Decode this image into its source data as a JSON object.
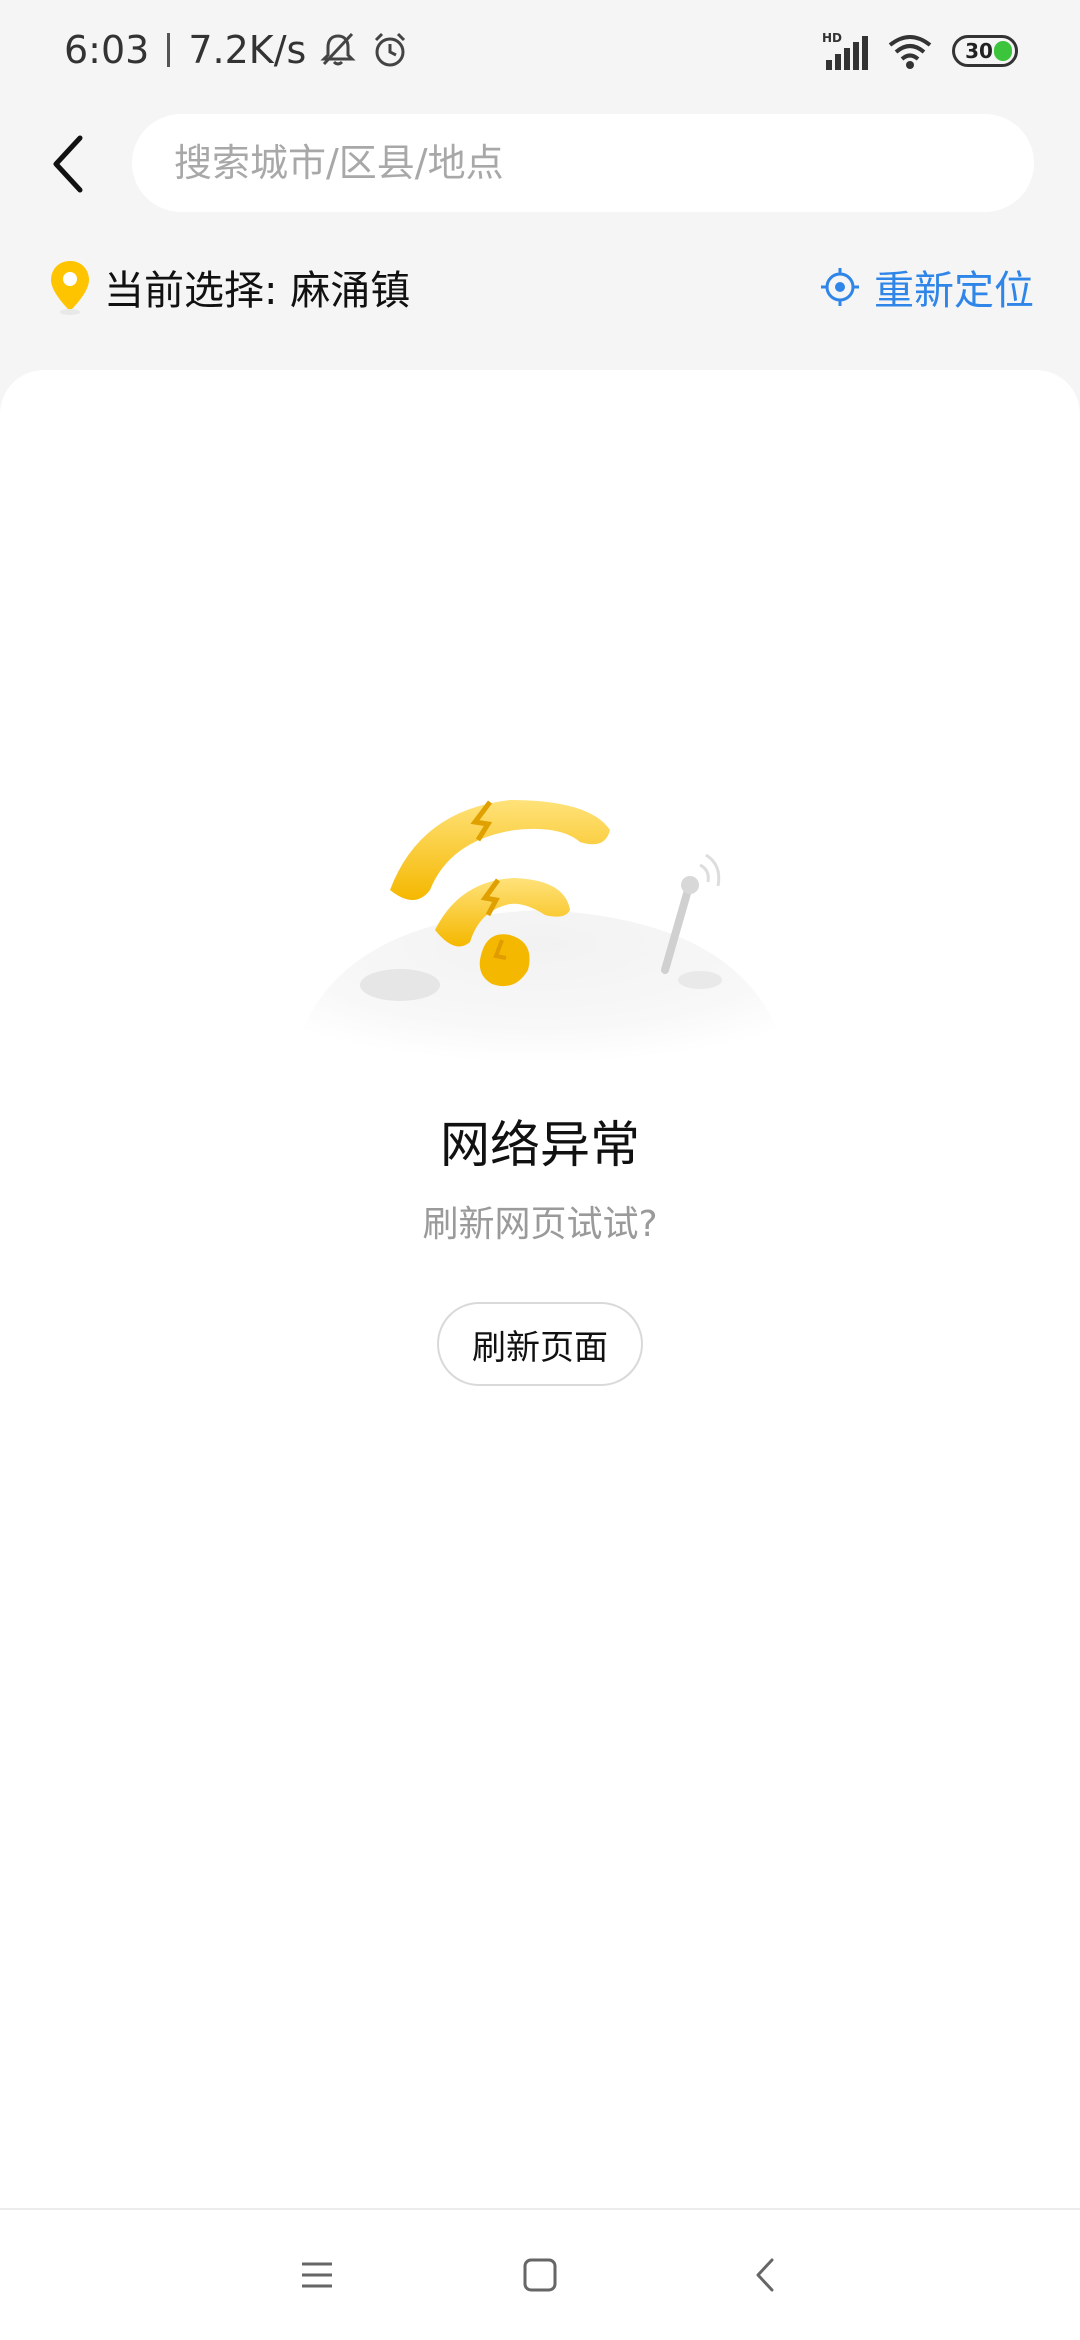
{
  "status_bar": {
    "time": "6:03",
    "speed": "7.2K/s",
    "network_label": "HD",
    "battery": "30",
    "icons": [
      "bell-off-icon",
      "alarm-icon",
      "signal-icon",
      "wifi-icon",
      "battery-icon"
    ]
  },
  "header": {
    "back_icon": "back-arrow-icon",
    "search_placeholder": "搜索城市/区县/地点"
  },
  "location": {
    "current_label": "当前选择: 麻涌镇",
    "relocate_label": "重新定位",
    "accent_color": "#2f86e8",
    "pin_color": "#ffc400"
  },
  "error": {
    "title": "网络异常",
    "subtitle": "刷新网页试试?",
    "refresh_button": "刷新页面"
  },
  "nav": {
    "icons": [
      "menu-icon",
      "home-icon",
      "back-icon"
    ]
  }
}
